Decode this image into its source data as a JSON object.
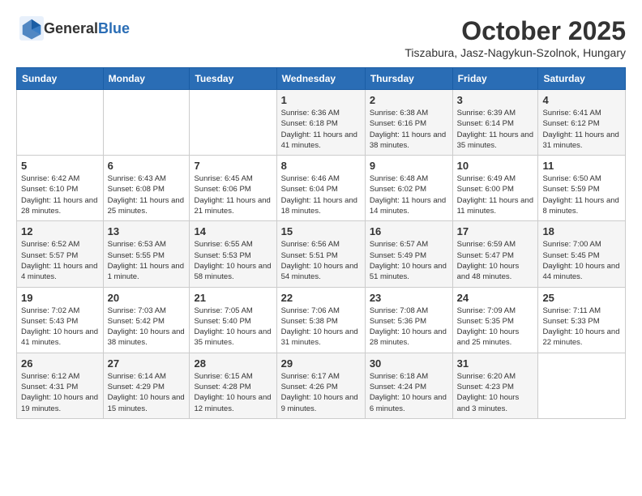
{
  "header": {
    "logo_general": "General",
    "logo_blue": "Blue",
    "month_title": "October 2025",
    "subtitle": "Tiszabura, Jasz-Nagykun-Szolnok, Hungary"
  },
  "weekdays": [
    "Sunday",
    "Monday",
    "Tuesday",
    "Wednesday",
    "Thursday",
    "Friday",
    "Saturday"
  ],
  "weeks": [
    [
      {
        "day": "",
        "info": ""
      },
      {
        "day": "",
        "info": ""
      },
      {
        "day": "",
        "info": ""
      },
      {
        "day": "1",
        "info": "Sunrise: 6:36 AM\nSunset: 6:18 PM\nDaylight: 11 hours and 41 minutes."
      },
      {
        "day": "2",
        "info": "Sunrise: 6:38 AM\nSunset: 6:16 PM\nDaylight: 11 hours and 38 minutes."
      },
      {
        "day": "3",
        "info": "Sunrise: 6:39 AM\nSunset: 6:14 PM\nDaylight: 11 hours and 35 minutes."
      },
      {
        "day": "4",
        "info": "Sunrise: 6:41 AM\nSunset: 6:12 PM\nDaylight: 11 hours and 31 minutes."
      }
    ],
    [
      {
        "day": "5",
        "info": "Sunrise: 6:42 AM\nSunset: 6:10 PM\nDaylight: 11 hours and 28 minutes."
      },
      {
        "day": "6",
        "info": "Sunrise: 6:43 AM\nSunset: 6:08 PM\nDaylight: 11 hours and 25 minutes."
      },
      {
        "day": "7",
        "info": "Sunrise: 6:45 AM\nSunset: 6:06 PM\nDaylight: 11 hours and 21 minutes."
      },
      {
        "day": "8",
        "info": "Sunrise: 6:46 AM\nSunset: 6:04 PM\nDaylight: 11 hours and 18 minutes."
      },
      {
        "day": "9",
        "info": "Sunrise: 6:48 AM\nSunset: 6:02 PM\nDaylight: 11 hours and 14 minutes."
      },
      {
        "day": "10",
        "info": "Sunrise: 6:49 AM\nSunset: 6:00 PM\nDaylight: 11 hours and 11 minutes."
      },
      {
        "day": "11",
        "info": "Sunrise: 6:50 AM\nSunset: 5:59 PM\nDaylight: 11 hours and 8 minutes."
      }
    ],
    [
      {
        "day": "12",
        "info": "Sunrise: 6:52 AM\nSunset: 5:57 PM\nDaylight: 11 hours and 4 minutes."
      },
      {
        "day": "13",
        "info": "Sunrise: 6:53 AM\nSunset: 5:55 PM\nDaylight: 11 hours and 1 minute."
      },
      {
        "day": "14",
        "info": "Sunrise: 6:55 AM\nSunset: 5:53 PM\nDaylight: 10 hours and 58 minutes."
      },
      {
        "day": "15",
        "info": "Sunrise: 6:56 AM\nSunset: 5:51 PM\nDaylight: 10 hours and 54 minutes."
      },
      {
        "day": "16",
        "info": "Sunrise: 6:57 AM\nSunset: 5:49 PM\nDaylight: 10 hours and 51 minutes."
      },
      {
        "day": "17",
        "info": "Sunrise: 6:59 AM\nSunset: 5:47 PM\nDaylight: 10 hours and 48 minutes."
      },
      {
        "day": "18",
        "info": "Sunrise: 7:00 AM\nSunset: 5:45 PM\nDaylight: 10 hours and 44 minutes."
      }
    ],
    [
      {
        "day": "19",
        "info": "Sunrise: 7:02 AM\nSunset: 5:43 PM\nDaylight: 10 hours and 41 minutes."
      },
      {
        "day": "20",
        "info": "Sunrise: 7:03 AM\nSunset: 5:42 PM\nDaylight: 10 hours and 38 minutes."
      },
      {
        "day": "21",
        "info": "Sunrise: 7:05 AM\nSunset: 5:40 PM\nDaylight: 10 hours and 35 minutes."
      },
      {
        "day": "22",
        "info": "Sunrise: 7:06 AM\nSunset: 5:38 PM\nDaylight: 10 hours and 31 minutes."
      },
      {
        "day": "23",
        "info": "Sunrise: 7:08 AM\nSunset: 5:36 PM\nDaylight: 10 hours and 28 minutes."
      },
      {
        "day": "24",
        "info": "Sunrise: 7:09 AM\nSunset: 5:35 PM\nDaylight: 10 hours and 25 minutes."
      },
      {
        "day": "25",
        "info": "Sunrise: 7:11 AM\nSunset: 5:33 PM\nDaylight: 10 hours and 22 minutes."
      }
    ],
    [
      {
        "day": "26",
        "info": "Sunrise: 6:12 AM\nSunset: 4:31 PM\nDaylight: 10 hours and 19 minutes."
      },
      {
        "day": "27",
        "info": "Sunrise: 6:14 AM\nSunset: 4:29 PM\nDaylight: 10 hours and 15 minutes."
      },
      {
        "day": "28",
        "info": "Sunrise: 6:15 AM\nSunset: 4:28 PM\nDaylight: 10 hours and 12 minutes."
      },
      {
        "day": "29",
        "info": "Sunrise: 6:17 AM\nSunset: 4:26 PM\nDaylight: 10 hours and 9 minutes."
      },
      {
        "day": "30",
        "info": "Sunrise: 6:18 AM\nSunset: 4:24 PM\nDaylight: 10 hours and 6 minutes."
      },
      {
        "day": "31",
        "info": "Sunrise: 6:20 AM\nSunset: 4:23 PM\nDaylight: 10 hours and 3 minutes."
      },
      {
        "day": "",
        "info": ""
      }
    ]
  ]
}
